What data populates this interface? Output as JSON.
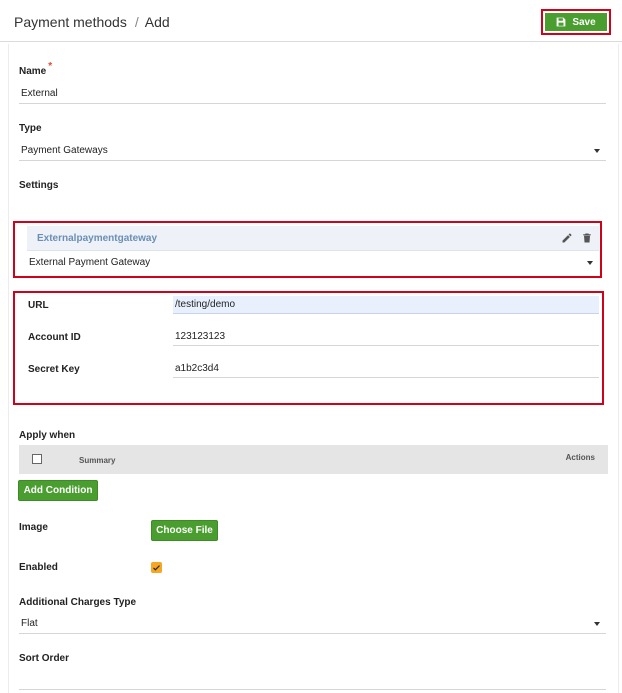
{
  "header": {
    "breadcrumb_root": "Payment methods",
    "breadcrumb_sep": "/",
    "breadcrumb_current": "Add",
    "save_label": "Save"
  },
  "form": {
    "name": {
      "label": "Name",
      "required_mark": "*",
      "value": "External"
    },
    "type": {
      "label": "Type",
      "value": "Payment Gateways"
    },
    "settings": {
      "label": "Settings",
      "gateway_title": "Externalpaymentgateway",
      "gateway_select": "External Payment Gateway",
      "fields": [
        {
          "label": "URL",
          "value": "/testing/demo"
        },
        {
          "label": "Account ID",
          "value": "123123123"
        },
        {
          "label": "Secret Key",
          "value": "a1b2c3d4"
        }
      ]
    },
    "apply_when": {
      "label": "Apply when",
      "columns": {
        "summary": "Summary",
        "actions": "Actions"
      },
      "add_condition_label": "Add Condition"
    },
    "image": {
      "label": "Image",
      "button_label": "Choose File"
    },
    "enabled": {
      "label": "Enabled",
      "checked": true
    },
    "additional_charges_type": {
      "label": "Additional Charges Type",
      "value": "Flat"
    },
    "sort_order": {
      "label": "Sort Order",
      "value": ""
    }
  },
  "colors": {
    "accent_green": "#4a9d2f",
    "highlight_red": "#d0021b",
    "checkbox_orange": "#f5a623",
    "gateway_title_blue": "#6a8fb5"
  },
  "icons": [
    "save-icon",
    "pencil-icon",
    "trash-icon",
    "checkmark-icon",
    "chevron-down-icon"
  ]
}
